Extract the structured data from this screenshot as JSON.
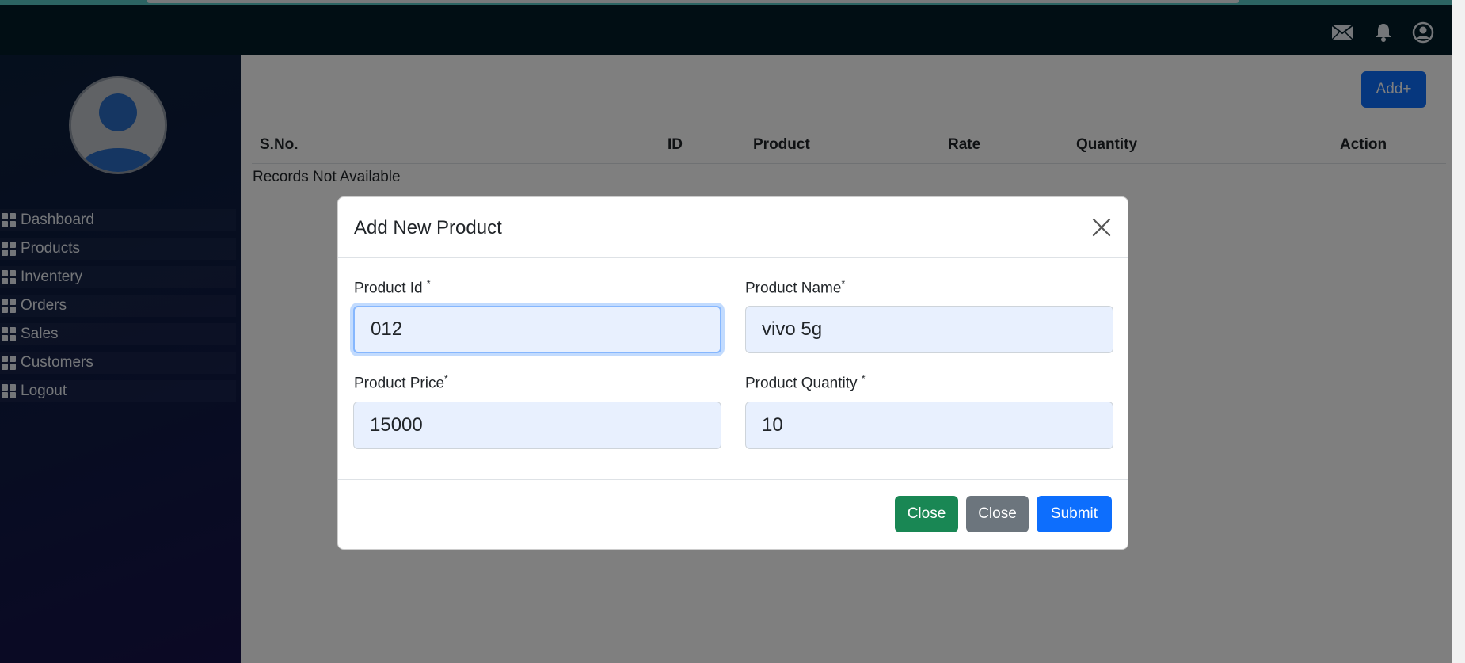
{
  "header": {
    "icons": [
      "mail-icon",
      "bell-icon",
      "user-circle-icon"
    ]
  },
  "sidebar": {
    "avatar_icon": "user-avatar-icon",
    "items": [
      {
        "label": "Dashboard",
        "icon": "grid-icon"
      },
      {
        "label": "Products",
        "icon": "grid-icon"
      },
      {
        "label": "Inventery",
        "icon": "grid-icon"
      },
      {
        "label": "Orders",
        "icon": "grid-icon"
      },
      {
        "label": "Sales",
        "icon": "grid-icon"
      },
      {
        "label": "Customers",
        "icon": "grid-icon"
      },
      {
        "label": "Logout",
        "icon": "grid-icon"
      }
    ]
  },
  "main": {
    "add_button": "Add+",
    "table": {
      "columns": [
        "S.No.",
        "ID",
        "Product",
        "Rate",
        "Quantity",
        "Action"
      ],
      "empty_message": "Records Not Available"
    }
  },
  "modal": {
    "title": "Add New Product",
    "fields": {
      "product_id": {
        "label": "Product Id",
        "required_mark": "*",
        "value": "012"
      },
      "product_name": {
        "label": "Product Name",
        "required_mark": "*",
        "value": "vivo 5g"
      },
      "product_price": {
        "label": "Product Price",
        "required_mark": "*",
        "value": "15000"
      },
      "product_quantity": {
        "label": "Product Quantity",
        "required_mark": "*",
        "value": "10"
      }
    },
    "buttons": {
      "close_green": "Close",
      "close_gray": "Close",
      "submit": "Submit"
    }
  },
  "colors": {
    "header_bg": "#021c28",
    "accent": "#58c9c6",
    "primary": "#0d6efd",
    "success": "#198754",
    "secondary": "#6c757d",
    "input_bg": "#e8f0fe"
  }
}
